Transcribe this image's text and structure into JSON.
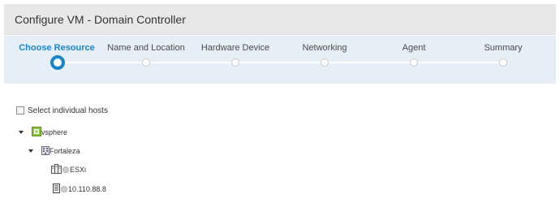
{
  "header": {
    "title": "Configure VM - Domain Controller"
  },
  "wizard": {
    "steps": [
      {
        "label": "Choose Resource",
        "active": true
      },
      {
        "label": "Name and Location",
        "active": false
      },
      {
        "label": "Hardware Device",
        "active": false
      },
      {
        "label": "Networking",
        "active": false
      },
      {
        "label": "Agent",
        "active": false
      },
      {
        "label": "Summary",
        "active": false
      }
    ]
  },
  "hosts_option": {
    "label": "Select individual hosts",
    "checked": false
  },
  "tree": {
    "root": {
      "label": "vsphere",
      "icon": "vsphere-icon",
      "expanded": true
    },
    "datacenter": {
      "label": "Fortaleza",
      "icon": "datacenter-icon",
      "expanded": true
    },
    "cluster": {
      "label": "ESXi",
      "icon": "cluster-icon"
    },
    "host": {
      "label": "10.110.88.8",
      "icon": "host-server-icon"
    }
  },
  "colors": {
    "accent": "#1a86c8",
    "wizard_bg": "#e6eef8",
    "header_bg": "#e8e8e8",
    "vsphere_green": "#8ac43f"
  }
}
